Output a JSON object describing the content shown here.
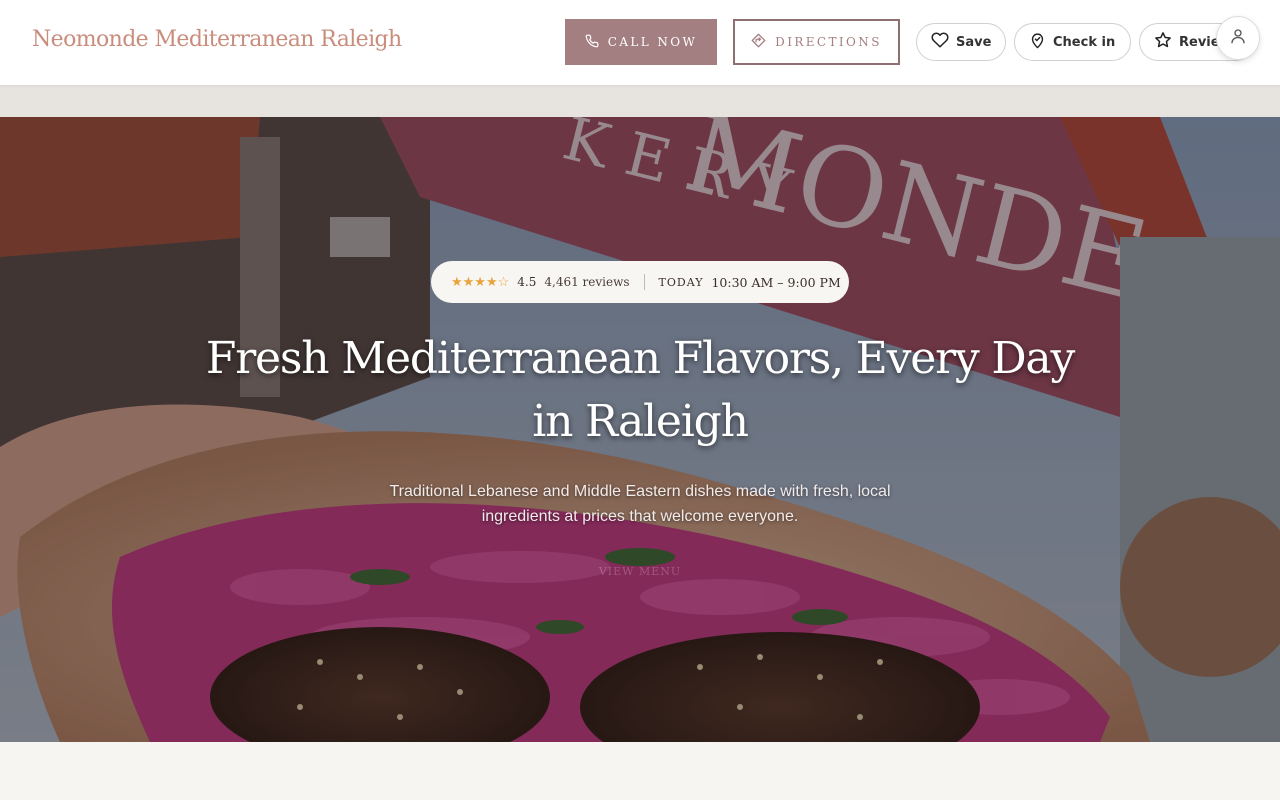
{
  "header": {
    "brand": "Neomonde Mediterranean Raleigh",
    "call_label": "CALL NOW",
    "directions_label": "DIRECTIONS",
    "save_label": "Save",
    "checkin_label": "Check in",
    "review_label": "Review"
  },
  "hero": {
    "stars": "★★★★☆",
    "rating": "4.5",
    "reviews": "4,461 reviews",
    "today_label": "TODAY",
    "hours": "10:30 AM – 9:00 PM",
    "title": "Fresh Mediterranean Flavors, Every Day in Raleigh",
    "subtitle": "Traditional Lebanese and Middle Eastern dishes made with fresh, local ingredients at prices that welcome everyone.",
    "cta": "VIEW MENU"
  },
  "colors": {
    "brand": "#c98d7d",
    "primary_button": "#a47f81",
    "star": "#e8a33a"
  },
  "icons": [
    "phone-icon",
    "directions-icon",
    "heart-icon",
    "location-pin-icon",
    "star-icon",
    "user-icon"
  ]
}
